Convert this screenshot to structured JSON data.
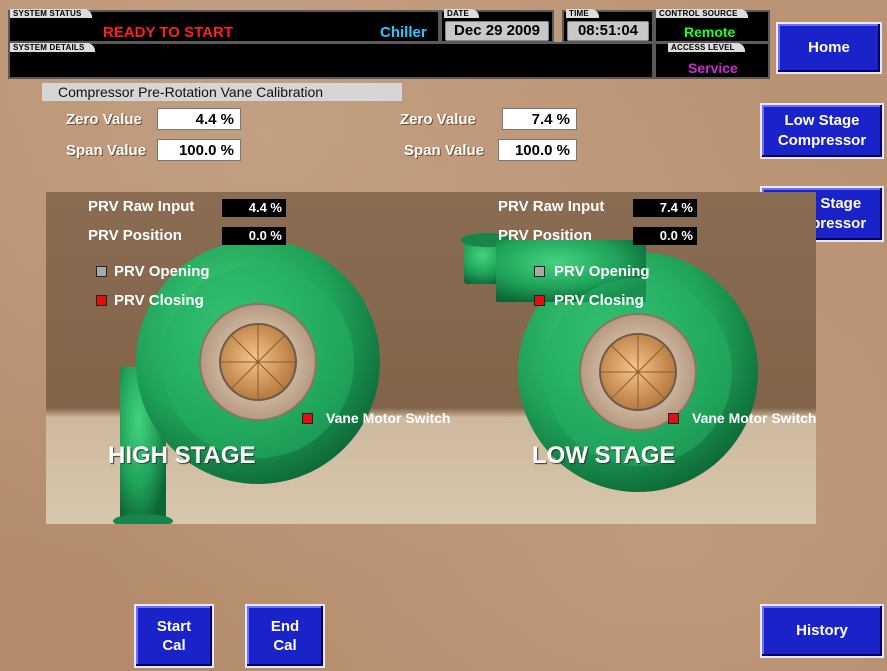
{
  "header": {
    "system_status_tag": "SYSTEM STATUS",
    "system_status": "READY TO START",
    "system_details_tag": "SYSTEM DETAILS",
    "unit_type": "Chiller",
    "date_tag": "DATE",
    "date": "Dec 29 2009",
    "time_tag": "TIME",
    "time": "08:51:04",
    "control_source_tag": "CONTROL SOURCE",
    "control_source": "Remote",
    "access_level_tag": "ACCESS LEVEL",
    "access_level": "Service"
  },
  "nav": {
    "home": "Home",
    "low_stage_line1": "Low Stage",
    "low_stage_line2": "Compressor",
    "high_stage_line1": "High Stage",
    "high_stage_line2": "Compressor",
    "history": "History"
  },
  "calibration": {
    "title": "Compressor Pre-Rotation Vane Calibration",
    "left": {
      "zero_label": "Zero Value",
      "zero_value": "4.4 %",
      "span_label": "Span Value",
      "span_value": "100.0 %"
    },
    "right": {
      "zero_label": "Zero Value",
      "zero_value": "7.4 %",
      "span_label": "Span Value",
      "span_value": "100.0 %"
    }
  },
  "panel": {
    "high": {
      "raw_label": "PRV Raw Input",
      "raw_value": "4.4 %",
      "pos_label": "PRV Position",
      "pos_value": "0.0 %",
      "opening_label": "PRV Opening",
      "closing_label": "PRV Closing",
      "switch_label": "Vane Motor Switch",
      "stage_label": "HIGH STAGE"
    },
    "low": {
      "raw_label": "PRV Raw Input",
      "raw_value": "7.4 %",
      "pos_label": "PRV Position",
      "pos_value": "0.0 %",
      "opening_label": "PRV Opening",
      "closing_label": "PRV Closing",
      "switch_label": "Vane Motor Switch",
      "stage_label": "LOW STAGE"
    }
  },
  "actions": {
    "start_line1": "Start",
    "start_line2": "Cal",
    "end_line1": "End",
    "end_line2": "Cal"
  },
  "colors": {
    "status_red": "#ff2020",
    "chiller_cyan": "#27c9ff",
    "remote_green": "#22ff22",
    "service_magenta": "#d02ad0",
    "indicator_gray": "#a9a9a9",
    "indicator_red": "#e01010",
    "compressor_green": "#1fa25a",
    "button_blue": "#1a22c9"
  }
}
